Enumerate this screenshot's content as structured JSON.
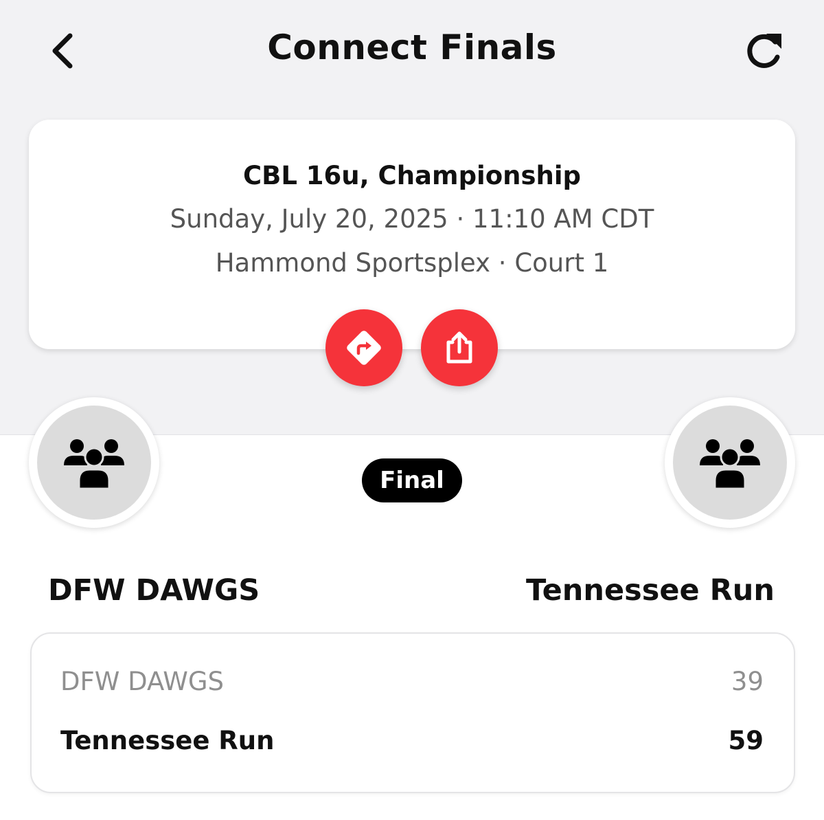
{
  "header": {
    "title": "Connect Finals",
    "back_icon": "chevron-left-icon",
    "refresh_icon": "refresh-icon"
  },
  "game": {
    "title": "CBL 16u, Championship",
    "datetime": "Sunday, July 20, 2025 · 11:10 AM CDT",
    "venue": "Hammond Sportsplex · Court 1"
  },
  "actions": {
    "directions_icon": "directions-icon",
    "share_icon": "share-icon",
    "accent_color": "#f5333a"
  },
  "matchup": {
    "status": "Final",
    "home_team": "DFW DAWGS",
    "away_team": "Tennessee Run",
    "team_avatar_icon": "group-icon"
  },
  "scores": [
    {
      "team": "DFW DAWGS",
      "score": "39",
      "winner": false
    },
    {
      "team": "Tennessee Run",
      "score": "59",
      "winner": true
    }
  ]
}
